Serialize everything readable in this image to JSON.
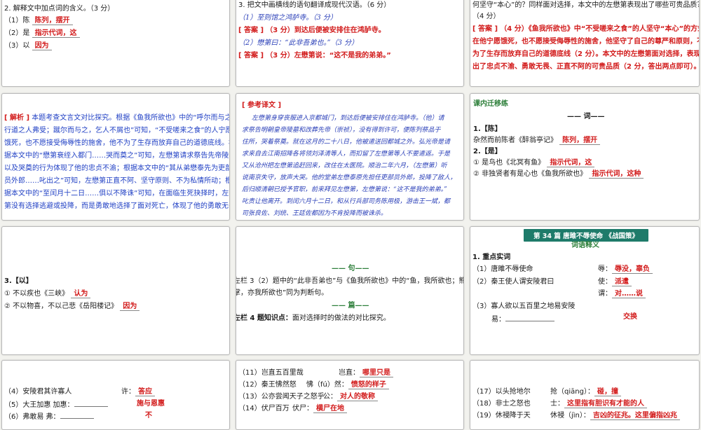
{
  "p1": {
    "heading": "2. 解释文中加点词的含义。（3 分）",
    "items": [
      {
        "num": "（1）",
        "word": "陈",
        "answer": "陈列，摆开"
      },
      {
        "num": "（2）",
        "word": "是",
        "answer": "指示代词，这"
      },
      {
        "num": "（3）",
        "word": "以",
        "answer": "因为"
      }
    ]
  },
  "p2": {
    "heading": "3. 把文中画横线的语句翻译成现代汉语。（6 分）",
    "q1": "（1）至则馆之鸿胪寺。（3 分）",
    "a1_tag": "[ 答案 ]",
    "a1": "（3 分）到达后便被安排住在鸿胪寺。",
    "q2": "（2）懋第曰：“此非吾弟也。”（3 分）",
    "a2_tag": "[ 答案 ]",
    "a2": "（3 分）左懋第说：“这不是我的弟弟。”"
  },
  "p3": {
    "line0": "何坚守“本心”的？同样面对选择，本文中的左懋第表现出了哪些可贵品质？",
    "line1": "（4 分）",
    "tag": "[ 答案 ]",
    "answer_lines": [
      "（4 分）《鱼我所欲也》中“不受嗟来之食”的人坚守“本心”的方式",
      "在他宁愿饿死，也不愿接受侮辱性的施舍，他坚守了自己的尊严和原则，不",
      "为了生存而放弃自己的道德底线（2 分）。本文中的左懋第面对选择，表现",
      "出了忠贞不渝、勇敢无畏、正直不阿的可贵品质（2 分，答出两点即可）。"
    ]
  },
  "p4": {
    "tag": "[ 解析 ]",
    "lines": [
      "本题考查文言文对比探究。根据《鱼我所欲也》中的“呼尔而与之，",
      "行道之人弗受；蹴尔而与之，乞人不屑也”可知，“不受嗟来之食”的人宁愿",
      "饿死，也不愿接受侮辱性的施舍，他不为了生存而放弃自己的道德底线。根",
      "据本文中的“懋第衰绖入都门……哭而奠之”可知，左懋第请求祭告先帝陵墓",
      "以及哭奠的行为体现了他的忠贞不渝；根据本文中的“其从弟懋泰先为吏部",
      "员外郎……叱出之”可知，左懋第正直不阿、坚守原则、不为私情所动；根",
      "据本文中的“至闰月十二日……俱以不降诛”可知，在面临生死抉择时，左懋",
      "第没有选择逃避或投降，而是勇敢地选择了面对死亡，体现了他的勇敢无畏。"
    ]
  },
  "p5": {
    "title": "[ 参考译文 ]",
    "lines": [
      "左懋第身穿丧服进入京都城门，到达后便被安排住在鸿胪寺。（他）请",
      "求祭告明朝皇帝陵墓和改葬先帝（崇祯），没有得到许可，便陈列祭品于",
      "住所，哭着祭奠。就在这月的二十八日，他被遣送回都城之外。弘光帝是请",
      "求来自去江南招降各将领刘泽清等人，而扣留了左懋第等人不要遣返。于是",
      "又从沧州把左懋第追赶回来，改住在太医院。顺治二年六月，（左懋第）听",
      "说南京失守，放声大哭。他的堂弟左懋泰原先担任吏部员外郎，投降了敌人，",
      "后归顺清朝已授予官职，前来拜见左懋第，左懋第说：“这不是我的弟弟。”",
      "叱责让他离开。到闰六月十二日，和从行兵部司务陈用极，游击王一斌，都",
      "司张良佐、刘统、王廷佐都因为不肯投降而被诛杀。"
    ]
  },
  "p6": {
    "title": "课内迁移练",
    "subtitle": "—— 词——",
    "h1": "1.【陈】",
    "l1": "杂然而前陈者《醉翁亭记》",
    "l1_ans": "陈列，摆开",
    "h2": "2.【是】",
    "l2": "① 是鸟也《北冥有鱼》",
    "l2_ans": "指示代词，这",
    "l3": "② 非独贤者有是心也《鱼我所欲也》",
    "l3_ans": "指示代词，这种"
  },
  "p7": {
    "h": "3.【以】",
    "l1": "① 不以疾也《三峡》",
    "l1_ans": "认为",
    "l2": "② 不以物喜，不以己悲《岳阳楼记》",
    "l2_ans": "因为"
  },
  "p8": {
    "title1": "—— 句——",
    "line1": "左栏 3（2）题中的“此非吾弟也”与《鱼我所欲也》中的“鱼，我所欲也；熊",
    "line2": "掌，亦我所欲也”同为判断句。",
    "title2": "—— 篇——",
    "line3_bold": "左栏 4 题知识点：",
    "line3": "面对选择时的做法的对比探究。"
  },
  "p9": {
    "banner": "第 34 篇  唐雎不辱使命 《战国策》",
    "title": "词语释义",
    "h": "1. 重点实词",
    "rows": [
      {
        "text": "（1）唐雎不辱使命",
        "key": "辱：",
        "ans": "辱没，辜负"
      },
      {
        "text": "（2）秦王使人谓安陵君曰",
        "key": "使：",
        "ans": "派遣"
      },
      {
        "text": "",
        "key": "谓：",
        "ans": "对……说"
      },
      {
        "text": "（3）寡人欲以五百里之地易安陵",
        "key": "",
        "ans": ""
      },
      {
        "text": "易：",
        "key": "",
        "ans": "交换"
      }
    ]
  },
  "p10": {
    "rows": [
      {
        "text": "（4）安陵君其许寡人",
        "key": "许：",
        "ans": "答应"
      },
      {
        "text": "（5）大王加惠   加惠：",
        "key": "",
        "ans": "施与恩惠"
      },
      {
        "text": "（6）弗敢易     弗：",
        "key": "",
        "ans": "不"
      }
    ]
  },
  "p11": {
    "rows": [
      {
        "text": "（11）岂直五百里哉",
        "key": "岂直：",
        "ans": "哪里只是"
      },
      {
        "text": "（12）秦王怫然怒",
        "key": "怫（fú）然：",
        "ans": "愤怒的样子"
      },
      {
        "text": "（13）公亦尝闻天子之怒乎",
        "key": "公：",
        "ans": "对人的敬称"
      },
      {
        "text": "（14）伏尸百万",
        "key": "伏尸：",
        "ans": "横尸在地"
      }
    ]
  },
  "p12": {
    "rows": [
      {
        "text": "（17）以头抢地尔",
        "key": "抢（qiāng）：",
        "ans": "碰，撞"
      },
      {
        "text": "（18）非士之怒也",
        "key": "士：",
        "ans": "这里指有胆识有才能的人"
      },
      {
        "text": "（19）休祲降于天",
        "key": "休祲（jìn）：",
        "ans": "吉凶的征兆。这里偏指凶兆"
      }
    ]
  }
}
